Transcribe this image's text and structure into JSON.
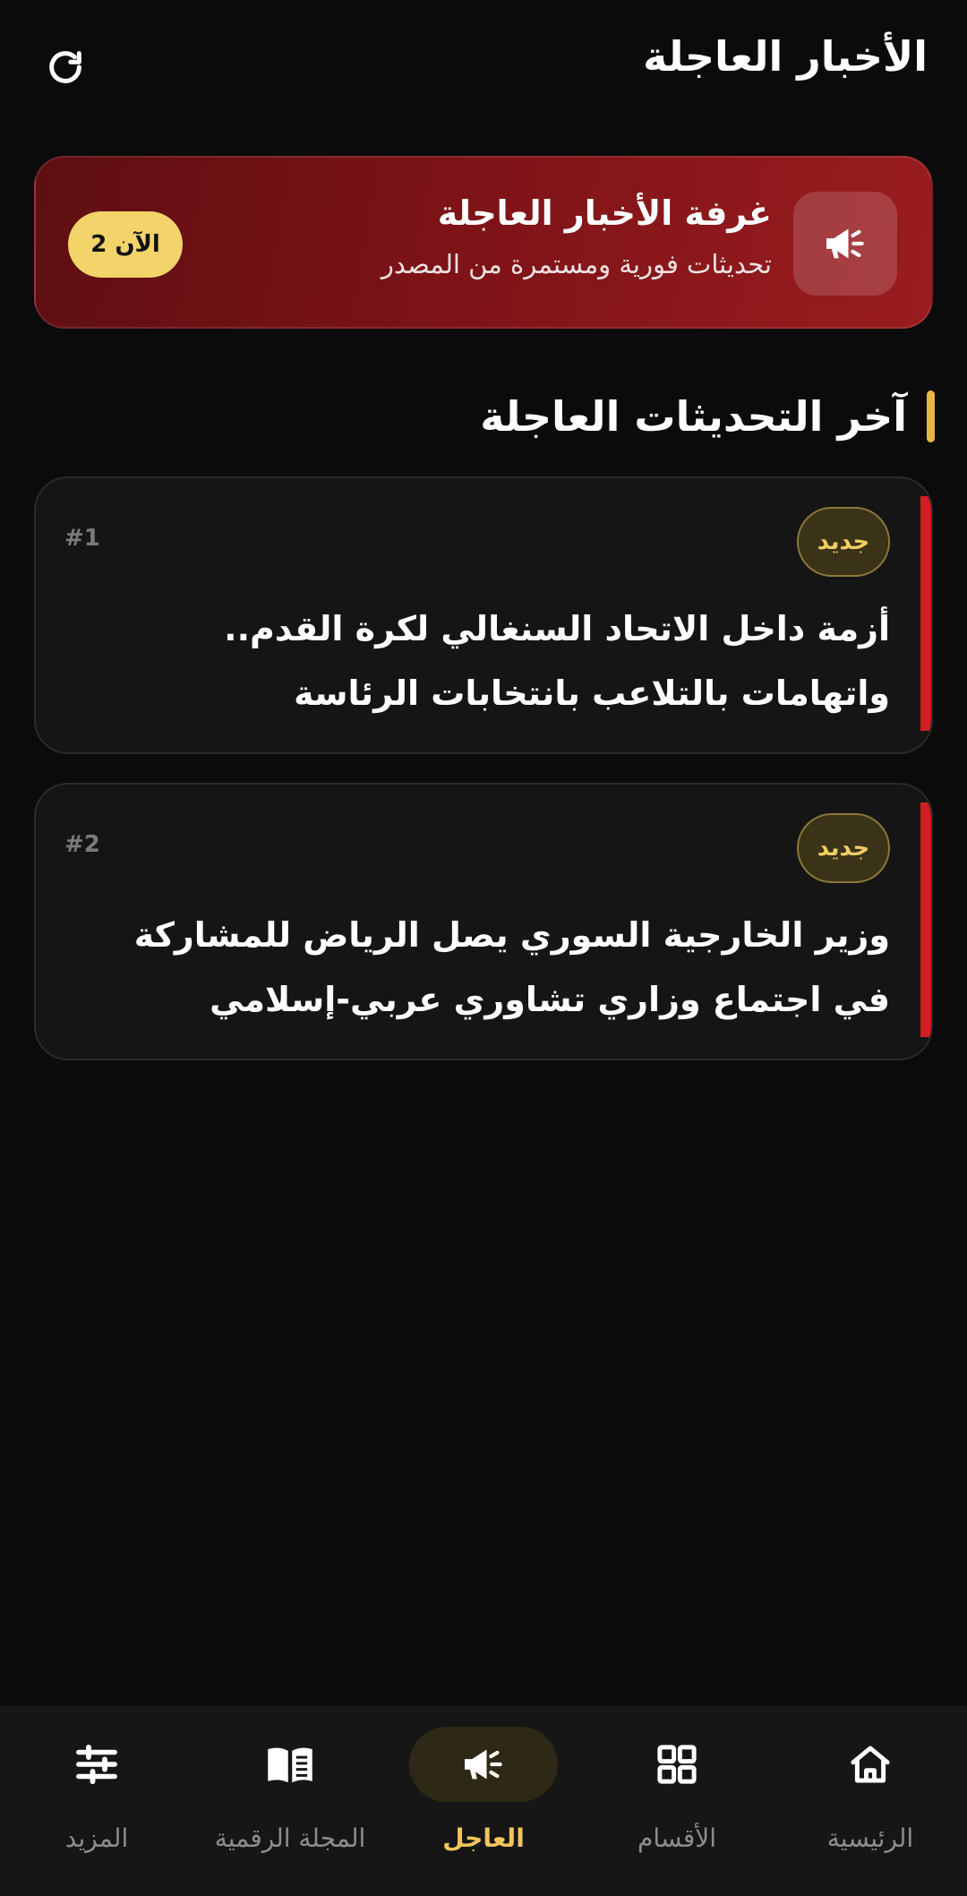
{
  "header": {
    "title": "الأخبار العاجلة",
    "refresh_icon": "refresh-icon"
  },
  "hero": {
    "title": "غرفة الأخبار العاجلة",
    "subtitle": "تحديثات فورية ومستمرة من المصدر",
    "badge": "الآن 2",
    "icon": "megaphone-icon",
    "colors": {
      "gradient_start": "#5e0f12",
      "gradient_end": "#9a1c1f",
      "badge": "#f3d46b"
    }
  },
  "section": {
    "title": "آخر التحديثات العاجلة",
    "accent": "#e7b545"
  },
  "news": [
    {
      "index": "#1",
      "badge": "جديد",
      "headline": "أزمة داخل الاتحاد السنغالي لكرة القدم.. واتهامات بالتلاعب بانتخابات الرئاسة"
    },
    {
      "index": "#2",
      "badge": "جديد",
      "headline": "وزير الخارجية السوري يصل الرياض للمشاركة في اجتماع وزاري تشاوري عربي-إسلامي"
    }
  ],
  "nav": {
    "active": "breaking",
    "active_color": "#f2c55c",
    "items": [
      {
        "key": "home",
        "label": "الرئيسية",
        "icon": "home-icon"
      },
      {
        "key": "sections",
        "label": "الأقسام",
        "icon": "grid-icon"
      },
      {
        "key": "breaking",
        "label": "العاجل",
        "icon": "megaphone-icon"
      },
      {
        "key": "magazine",
        "label": "المجلة الرقمية",
        "icon": "book-icon"
      },
      {
        "key": "more",
        "label": "المزيد",
        "icon": "sliders-icon"
      }
    ]
  }
}
